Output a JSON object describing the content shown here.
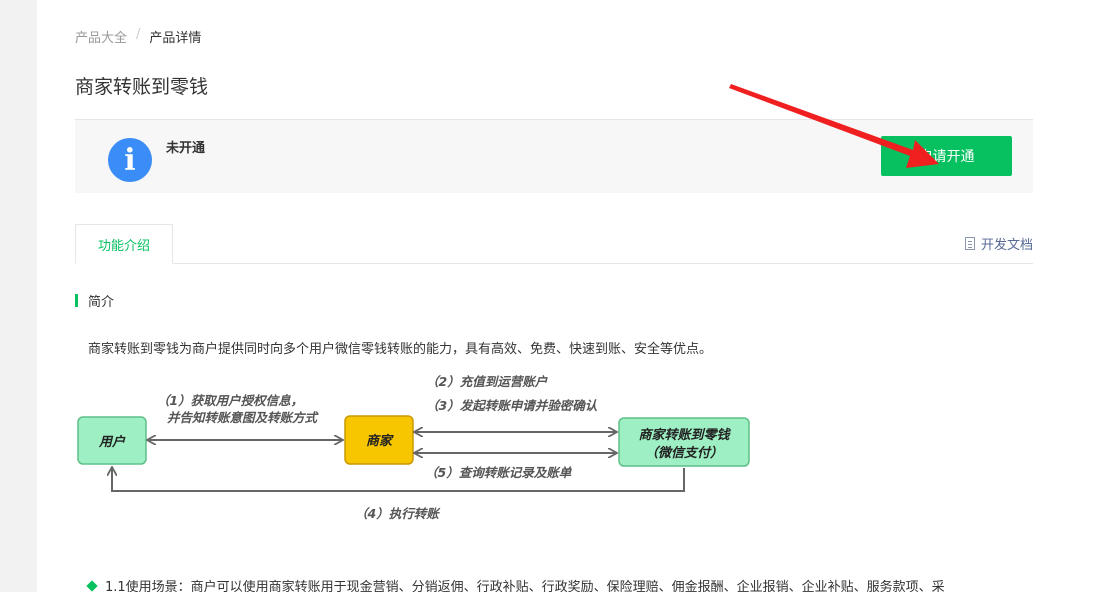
{
  "breadcrumb": {
    "parent": "产品大全",
    "separator": "/",
    "current": "产品详情"
  },
  "page": {
    "title": "商家转账到零钱"
  },
  "status": {
    "text": "未开通",
    "icon": "info-icon",
    "button_label": "申请开通"
  },
  "tabs": {
    "active": "功能介绍",
    "docs_link": "开发文档"
  },
  "section": {
    "heading": "简介"
  },
  "intro": "商家转账到零钱为商户提供同时向多个用户微信零钱转账的能力，具有高效、免费、快速到账、安全等优点。",
  "diagram": {
    "user_label": "用户",
    "merchant_label": "商家",
    "service_label_1": "商家转账到零钱",
    "service_label_2": "（微信支付）",
    "step1_line1": "（1）获取用户授权信息，",
    "step1_line2": "并告知转账意图及转账方式",
    "step2": "（2）充值到运营账户",
    "step3": "（3）发起转账申请并验密确认",
    "step5": "（5）查询转账记录及账单",
    "step4": "（4）执行转账"
  },
  "bullet": "1.1使用场景：商户可以使用商家转账用于现金营销、分销返佣、行政补贴、行政奖励、保险理赔、佣金报酬、企业报销、企业补贴、服务款项、采",
  "colors": {
    "accent": "#07c160",
    "info_blue": "#3a8cf7",
    "annotation_arrow": "#f02020"
  }
}
